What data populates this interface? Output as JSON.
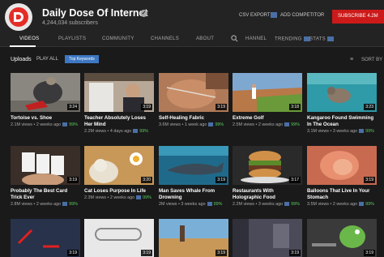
{
  "header": {
    "title": "Daily Dose Of Internet",
    "subscribers": "4,244,034 subscribers",
    "verified": "✓",
    "csv_export": "CSV EXPORT",
    "add_competitor": "ADD COMPETITOR",
    "subscribe": "SUBSCRIBE 4.2M"
  },
  "tabs": {
    "videos": "VIDEOS",
    "playlists": "PLAYLISTS",
    "community": "COMMUNITY",
    "channels": "CHANNELS",
    "about": "ABOUT",
    "channel": "HANNEL",
    "trending": "TRENDING",
    "stats": "STATS"
  },
  "toolbar": {
    "uploads": "Uploads",
    "play_all": "PLAY ALL",
    "top_keywords": "Top Keywords",
    "sort_by": "SORT BY"
  },
  "videos": [
    {
      "title": "Tortoise vs. Shoe",
      "views": "2.1M views",
      "age": "2 weeks ago",
      "pct": "99%",
      "duration": "3:24",
      "second_line": false
    },
    {
      "title": "Teacher Absolutely Loses Her Mind",
      "views": "2.2M views",
      "age": "4 days ago",
      "pct": "99%",
      "duration": "3:19",
      "second_line": true
    },
    {
      "title": "Self-Healing Fabric",
      "views": "3.6M views",
      "age": "1 week ago",
      "pct": "99%",
      "duration": "3:19",
      "second_line": false
    },
    {
      "title": "Extreme Golf",
      "views": "2.5M views",
      "age": "2 weeks ago",
      "pct": "99%",
      "duration": "3:18",
      "second_line": false
    },
    {
      "title": "Kangaroo Found Swimming In The Ocean",
      "views": "3.1M views",
      "age": "3 weeks ago",
      "pct": "99%",
      "duration": "3:23",
      "second_line": true
    },
    {
      "title": "Probably The Best Card Trick Ever",
      "views": "2.8M views",
      "age": "2 weeks ago",
      "pct": "99%",
      "duration": "3:19",
      "second_line": true
    },
    {
      "title": "Cat Loses Purpose In Life",
      "views": "2.3M views",
      "age": "2 weeks ago",
      "pct": "99%",
      "duration": "3:20",
      "second_line": false
    },
    {
      "title": "Man Saves Whale From Drowning",
      "views": "2M views",
      "age": "3 weeks ago",
      "pct": "99%",
      "duration": "3:19",
      "second_line": true
    },
    {
      "title": "Restaurants With Holographic Food",
      "views": "2.2M views",
      "age": "3 weeks ago",
      "pct": "99%",
      "duration": "3:17",
      "second_line": true
    },
    {
      "title": "Balloons That Live In Your Stomach",
      "views": "3.5M views",
      "age": "2 weeks ago",
      "pct": "99%",
      "duration": "3:19",
      "second_line": true
    },
    {
      "duration": "3:19"
    },
    {
      "duration": "3:19"
    },
    {
      "duration": "3:19"
    },
    {
      "duration": "3:19"
    },
    {
      "duration": "3:19"
    }
  ],
  "colors": {
    "background": "#1a1a1a",
    "header": "#232323",
    "subscribe": "#cc1a1a",
    "accent_blue": "#3d78c4",
    "rating_green": "#5ccb5f"
  }
}
